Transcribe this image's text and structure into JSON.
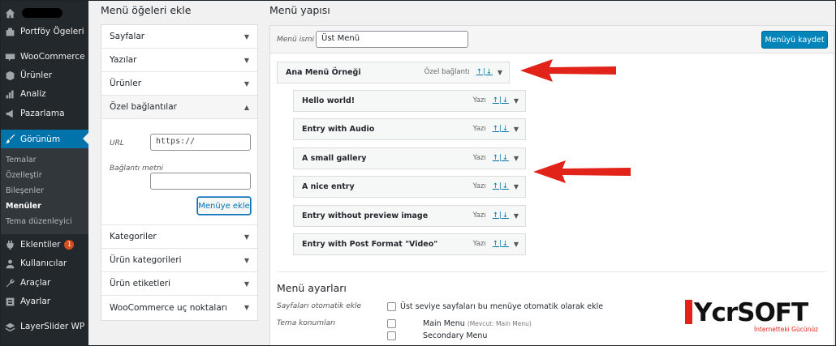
{
  "sidebar": {
    "items": [
      {
        "label": "",
        "icon": "home-icon",
        "redacted": true
      },
      {
        "label": "Portföy Ögeleri",
        "icon": "portfolio-icon"
      },
      {
        "label": "WooCommerce",
        "icon": "woocommerce-icon"
      },
      {
        "label": "Ürünler",
        "icon": "products-icon"
      },
      {
        "label": "Analiz",
        "icon": "analytics-icon"
      },
      {
        "label": "Pazarlama",
        "icon": "megaphone-icon"
      },
      {
        "label": "Görünüm",
        "icon": "brush-icon"
      },
      {
        "label": "Eklentiler",
        "icon": "plugin-icon",
        "badge": "1"
      },
      {
        "label": "Kullanıcılar",
        "icon": "users-icon"
      },
      {
        "label": "Araçlar",
        "icon": "tools-icon"
      },
      {
        "label": "Ayarlar",
        "icon": "settings-icon"
      },
      {
        "label": "LayerSlider WP",
        "icon": "layerslider-icon"
      }
    ],
    "submenu": [
      "Temalar",
      "Özelleştir",
      "Bileşenler",
      "Menüler",
      "Tema düzenleyici"
    ]
  },
  "left": {
    "title": "Menü öğeleri ekle",
    "sections_top": [
      "Sayfalar",
      "Yazılar",
      "Ürünler"
    ],
    "open_section": "Özel bağlantılar",
    "url_label": "URL",
    "url_value": "https://",
    "link_text_label": "Bağlantı metni",
    "add_button": "Menüye ekle",
    "sections_bottom": [
      "Kategoriler",
      "Ürün kategorileri",
      "Ürün etiketleri",
      "WooCommerce uç noktaları"
    ]
  },
  "right": {
    "title": "Menü yapısı",
    "menu_name_label": "Menü ismi",
    "menu_name_value": "Üst Menü",
    "save_button": "Menüyü kaydet",
    "move_label": "↑|↓",
    "items": [
      {
        "label": "Ana Menü Örneği",
        "type": "Özel bağlantı"
      },
      {
        "label": "Hello world!",
        "type": "Yazı"
      },
      {
        "label": "Entry with Audio",
        "type": "Yazı"
      },
      {
        "label": "A small gallery",
        "type": "Yazı"
      },
      {
        "label": "A nice entry",
        "type": "Yazı"
      },
      {
        "label": "Entry without preview image",
        "type": "Yazı"
      },
      {
        "label": "Entry with Post Format \"Video\"",
        "type": "Yazı"
      }
    ],
    "settings": {
      "title": "Menü ayarları",
      "auto_add_label": "Sayfaları otomatik ekle",
      "auto_add_text": "Üst seviye sayfaları bu menüye otomatik olarak ekle",
      "locations_label": "Tema konumları",
      "loc1": "Main Menu",
      "loc1_note": "(Mevcut: Main Menu)",
      "loc2": "Secondary Menu"
    }
  },
  "logo": {
    "text": "YcrSOFT",
    "tagline": "İnternetteki Gücünüz"
  },
  "colors": {
    "sidebar": "#23282d",
    "accent": "#0073aa",
    "arrow": "#e2231a"
  }
}
